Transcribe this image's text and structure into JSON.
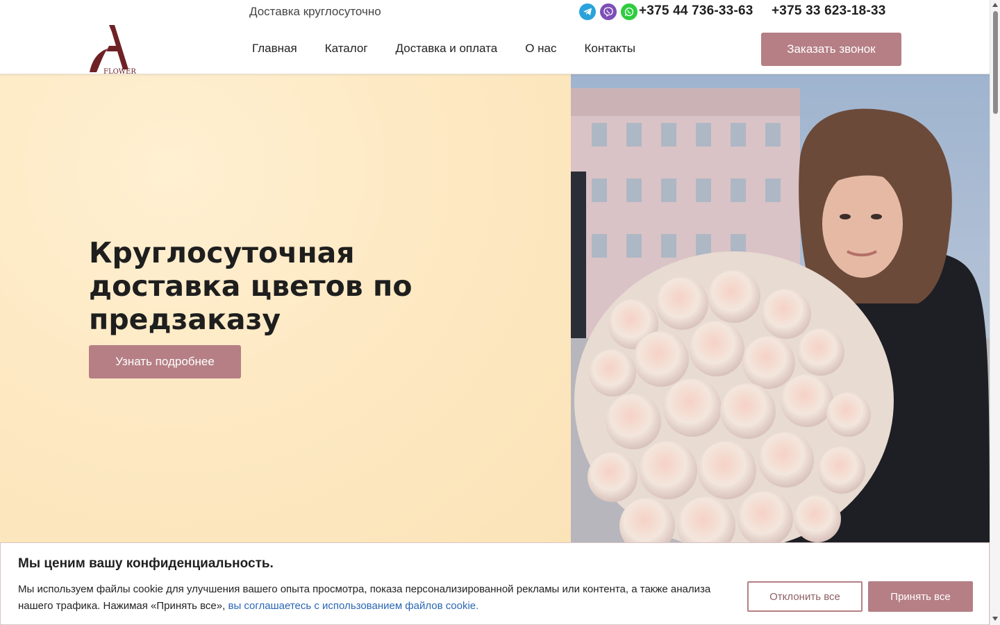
{
  "header": {
    "logo_text": "FLOWER",
    "topbar_text": "Доставка круглосуточно",
    "messengers": [
      "telegram-icon",
      "viber-icon",
      "whatsapp-icon"
    ],
    "phone_1": "+375 44 736-33-63",
    "phone_2": "+375 33 623-18-33",
    "nav": [
      "Главная",
      "Каталог",
      "Доставка и оплата",
      "О нас",
      "Контакты"
    ],
    "callback_label": "Заказать звонок"
  },
  "hero": {
    "title": "Круглосуточная доставка цветов по предзаказу",
    "button_label": "Узнать подробнее",
    "photo": "woman-with-bouquet-of-roses"
  },
  "cookie": {
    "title": "Мы ценим вашу конфиденциальность.",
    "text": "Мы используем файлы cookie для улучшения вашего опыта просмотра, показа персонализированной рекламы или контента, а также анализа нашего трафика. Нажимая «Принять все», ",
    "link_text": "вы соглашаетесь с использованием файлов cookie.",
    "decline_label": "Отклонить все",
    "accept_label": "Принять все"
  },
  "colors": {
    "accent": "#b57f85",
    "hero_bg": "#fde9c3",
    "logo": "#6e2226",
    "link": "#2a67b5"
  }
}
